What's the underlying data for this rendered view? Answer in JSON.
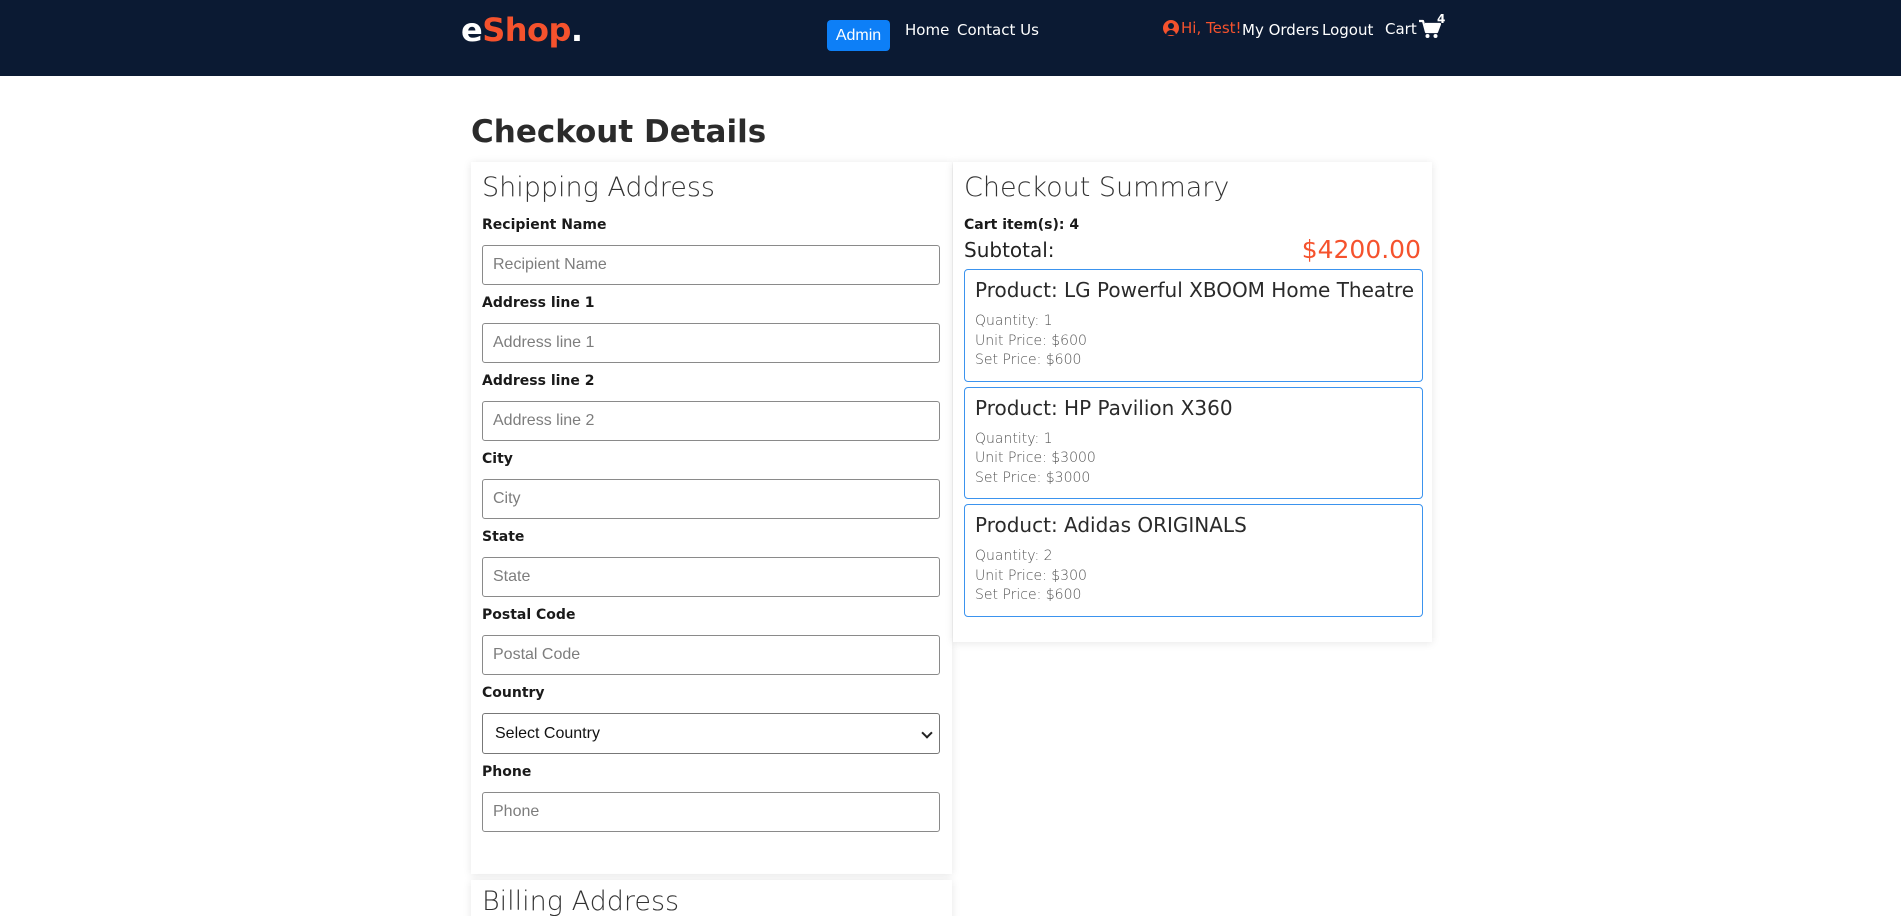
{
  "header": {
    "logo": {
      "e": "e",
      "shop": "Shop",
      "dot": "."
    },
    "admin_label": "Admin",
    "nav": {
      "home": "Home",
      "contact": "Contact Us"
    },
    "greeting": "Hi, Test!",
    "my_orders": "My Orders",
    "logout": "Logout",
    "cart_label": "Cart",
    "cart_count": "4"
  },
  "page_title": "Checkout Details",
  "shipping": {
    "title": "Shipping Address",
    "fields": [
      {
        "label": "Recipient Name",
        "placeholder": "Recipient Name",
        "value": ""
      },
      {
        "label": "Address line 1",
        "placeholder": "Address line 1",
        "value": ""
      },
      {
        "label": "Address line 2",
        "placeholder": "Address line 2",
        "value": ""
      },
      {
        "label": "City",
        "placeholder": "City",
        "value": ""
      },
      {
        "label": "State",
        "placeholder": "State",
        "value": ""
      },
      {
        "label": "Postal Code",
        "placeholder": "Postal Code",
        "value": ""
      }
    ],
    "country": {
      "label": "Country",
      "selected": "Select Country"
    },
    "phone": {
      "label": "Phone",
      "placeholder": "Phone",
      "value": ""
    }
  },
  "billing": {
    "title": "Billing Address"
  },
  "summary": {
    "title": "Checkout Summary",
    "count_text": "Cart item(s): 4",
    "subtotal_label": "Subtotal:",
    "subtotal_value": "$4200.00",
    "items": [
      {
        "name": "Product: LG Powerful XBOOM Home Theatre",
        "quantity": "Quantity: 1",
        "unit_price": "Unit Price: $600",
        "set_price": "Set Price: $600"
      },
      {
        "name": "Product: HP Pavilion X360",
        "quantity": "Quantity: 1",
        "unit_price": "Unit Price: $3000",
        "set_price": "Set Price: $3000"
      },
      {
        "name": "Product: Adidas ORIGINALS",
        "quantity": "Quantity: 2",
        "unit_price": "Unit Price: $300",
        "set_price": "Set Price: $600"
      }
    ]
  },
  "colors": {
    "header_bg": "#0b1a33",
    "accent": "#f5522d",
    "primary_button": "#0d7ff7",
    "item_border": "#3b93ee"
  },
  "icons": {
    "user": "user-circle-icon",
    "cart": "shopping-cart-icon",
    "select": "chevron-down-icon"
  }
}
